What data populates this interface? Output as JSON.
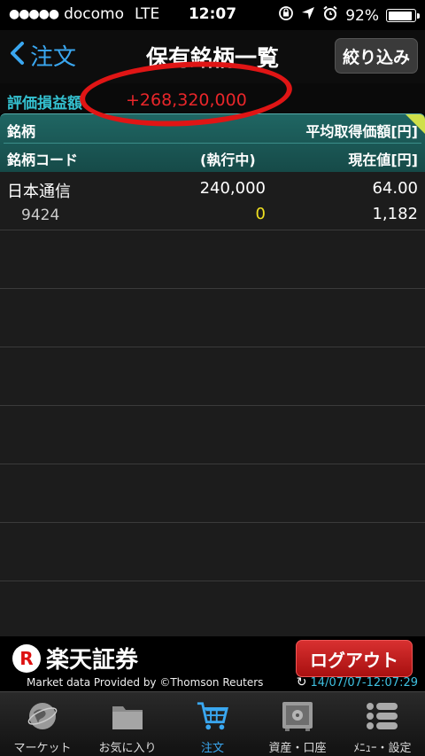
{
  "status_bar": {
    "carrier": "docomo",
    "network": "LTE",
    "time": "12:07",
    "battery": "92%",
    "battery_level": 0.92
  },
  "nav": {
    "back_label": "注文",
    "title": "保有銘柄一覧",
    "filter_label": "絞り込み"
  },
  "summary": {
    "label": "評価損益額",
    "value": "+268,320,000"
  },
  "table_header": {
    "col1_top": "銘柄",
    "col3_top": "平均取得価額[円]",
    "col1_bottom": "銘柄コード",
    "col2_bottom": "(執行中)",
    "col3_bottom": "現在値[円]"
  },
  "holdings": [
    {
      "name": "日本通信",
      "quantity": "240,000",
      "avg_price": "64.00",
      "code": "9424",
      "pending": "0",
      "current_price": "1,182"
    }
  ],
  "footer": {
    "brand": "楽天証券",
    "logout_label": "ログアウト",
    "provider": "Market data Provided by ©Thomson Reuters",
    "updated": "14/07/07-12:07:29"
  },
  "tabs": [
    {
      "label": "マーケット",
      "icon": "globe-icon"
    },
    {
      "label": "お気に入り",
      "icon": "folder-icon"
    },
    {
      "label": "注文",
      "icon": "cart-icon"
    },
    {
      "label": "資産・口座",
      "icon": "safe-icon"
    },
    {
      "label": "ﾒﾆｭｰ・設定",
      "icon": "menu-list-icon"
    }
  ],
  "colors": {
    "accent": "#3aa7f0",
    "gain_red": "#e8262a",
    "header_teal": "#1f6663",
    "pending_yellow": "#f0e020"
  }
}
